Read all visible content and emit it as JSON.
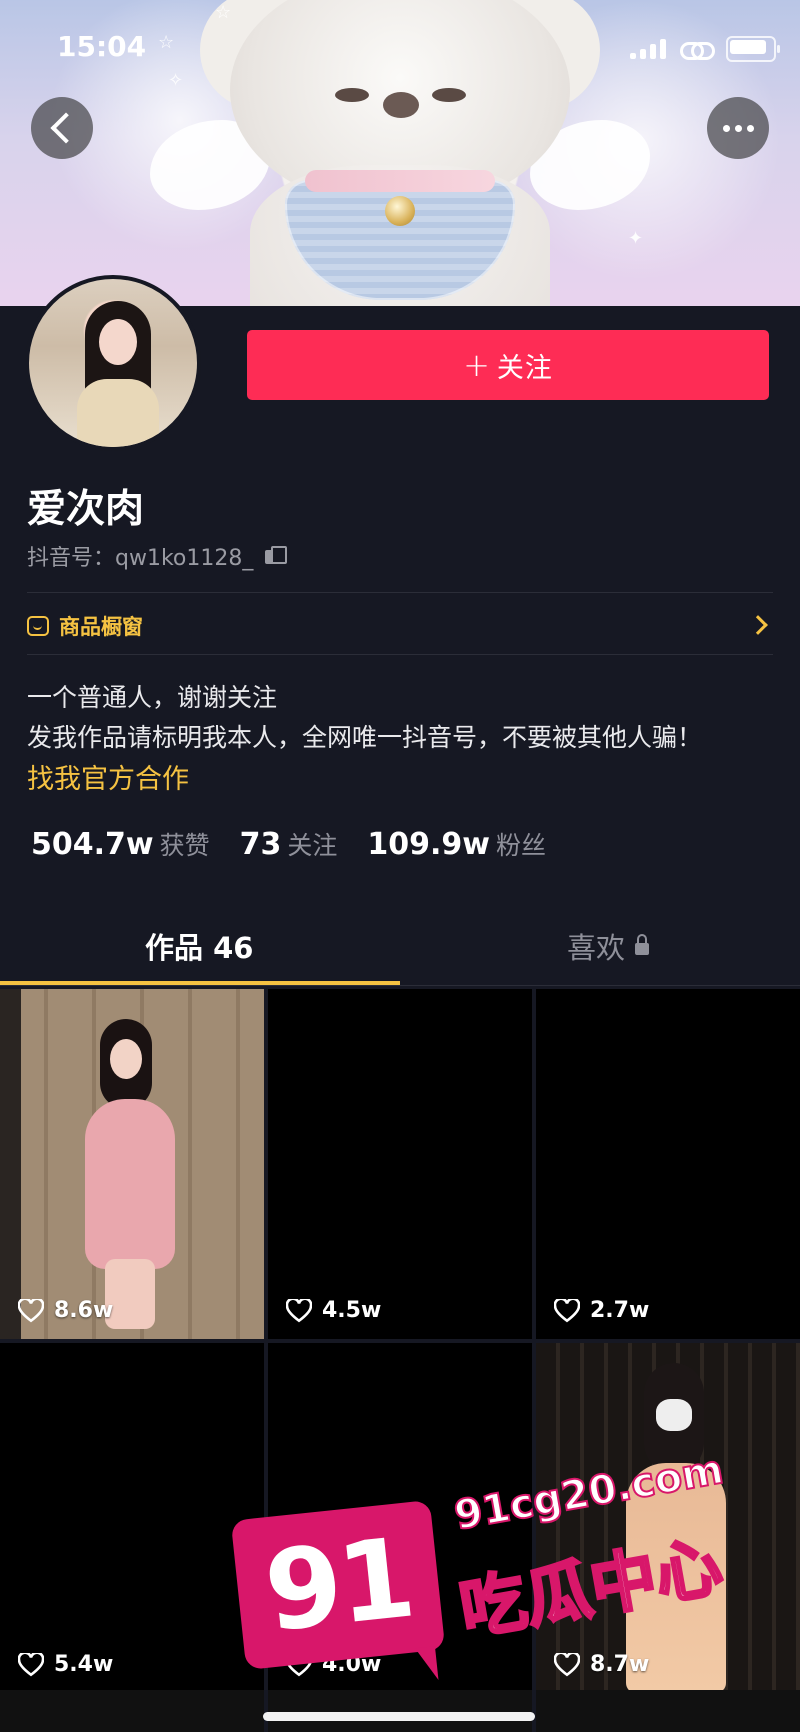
{
  "status_bar": {
    "time": "15:04"
  },
  "profile": {
    "follow_label": "关注",
    "nickname": "爱次肉",
    "douyin_id": "抖音号：qw1ko1128_",
    "shop_label": "商品橱窗",
    "bio": [
      "一个普通人，谢谢关注",
      "发我作品请标明我本人，全网唯一抖音号，不要被其他人骗！"
    ],
    "bio_link": "找我官方合作",
    "stats": [
      {
        "value": "504.7w",
        "label": "获赞"
      },
      {
        "value": "73",
        "label": "关注"
      },
      {
        "value": "109.9w",
        "label": "粉丝"
      }
    ]
  },
  "tabs": {
    "works": "作品 46",
    "likes": "喜欢"
  },
  "videos": [
    {
      "likes": "8.6w"
    },
    {
      "likes": "4.5w"
    },
    {
      "likes": "2.7w"
    },
    {
      "likes": "5.4w"
    },
    {
      "likes": "4.0w"
    },
    {
      "likes": "8.7w"
    }
  ],
  "watermark": {
    "badge": "91",
    "url": "91cg20.com",
    "text": "吃瓜中心"
  },
  "colors": {
    "accent_red": "#fe2c55",
    "accent_gold": "#f5c242",
    "background": "#161823"
  }
}
